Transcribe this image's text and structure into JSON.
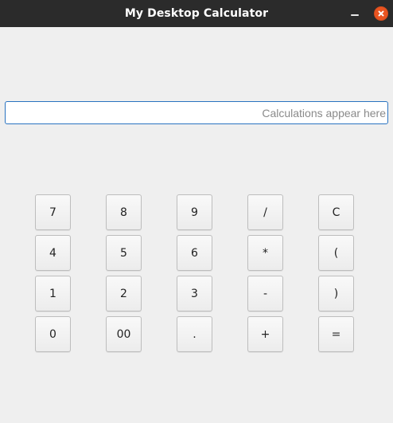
{
  "window": {
    "title": "My Desktop Calculator",
    "accent_close_color": "#e95420",
    "titlebar_color": "#2b2b2b",
    "controls": {
      "minimize_icon": "minimize-icon",
      "close_icon": "close-icon"
    }
  },
  "display": {
    "value": "",
    "placeholder": "Calculations appear here"
  },
  "keypad": {
    "row1": [
      "7",
      "8",
      "9",
      "/",
      "C"
    ],
    "row2": [
      "4",
      "5",
      "6",
      "*",
      "("
    ],
    "row3": [
      "1",
      "2",
      "3",
      "-",
      ")"
    ],
    "row4": [
      "0",
      "00",
      ".",
      "+",
      "="
    ]
  }
}
